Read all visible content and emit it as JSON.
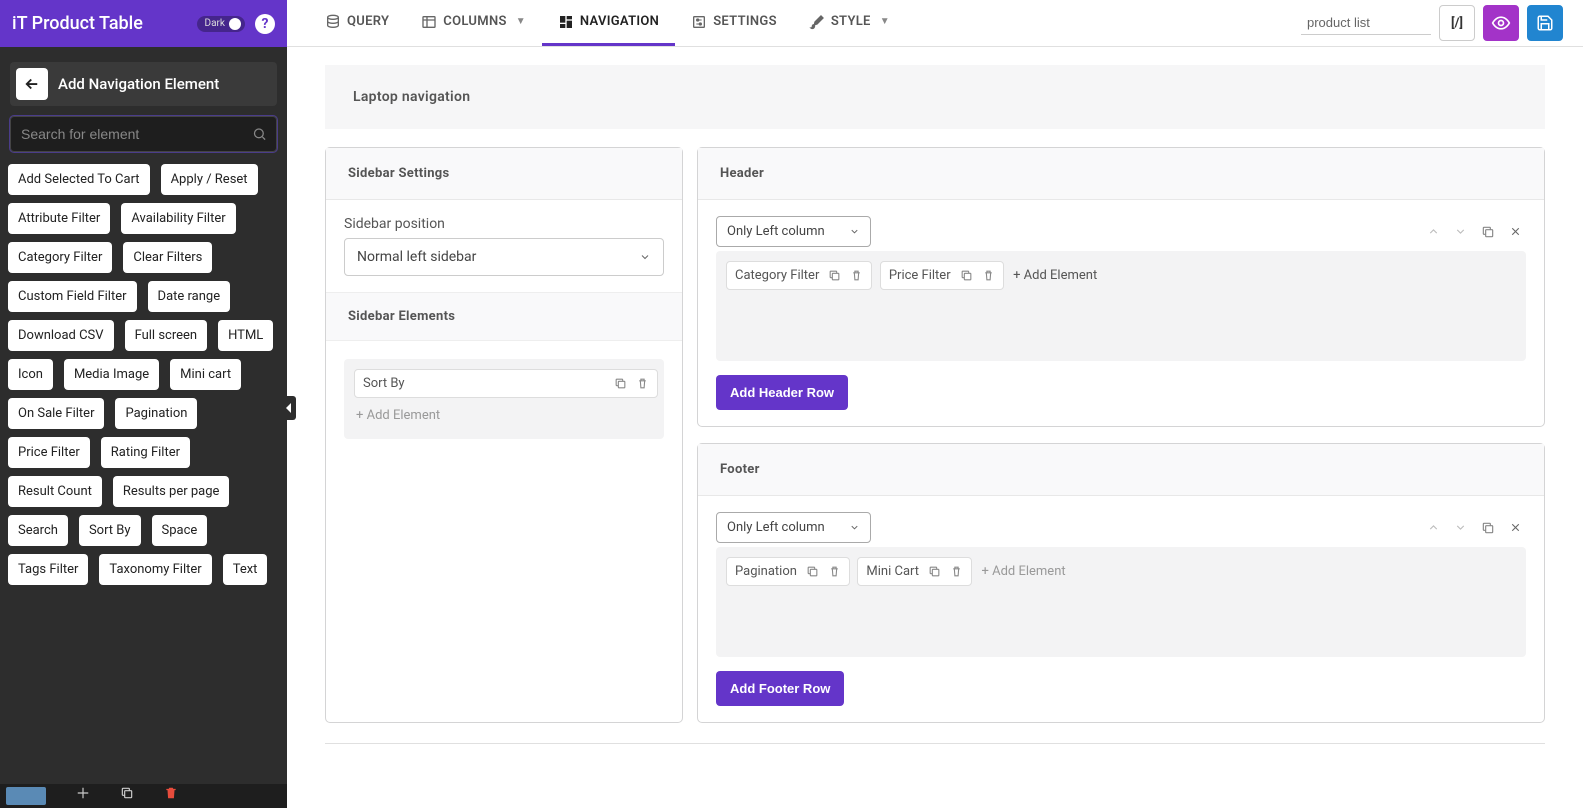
{
  "header": {
    "appTitle": "iT Product Table",
    "darkLabel": "Dark",
    "help": "?"
  },
  "sidebar": {
    "sectionTitle": "Add Navigation Element",
    "searchPlaceholder": "Search for element",
    "chips": [
      "Add Selected To Cart",
      "Apply / Reset",
      "Attribute Filter",
      "Availability Filter",
      "Category Filter",
      "Clear Filters",
      "Custom Field Filter",
      "Date range",
      "Download CSV",
      "Full screen",
      "HTML",
      "Icon",
      "Media Image",
      "Mini cart",
      "On Sale Filter",
      "Pagination",
      "Price Filter",
      "Rating Filter",
      "Result Count",
      "Results per page",
      "Search",
      "Sort By",
      "Space",
      "Tags Filter",
      "Taxonomy Filter",
      "Text"
    ]
  },
  "tabs": {
    "query": "QUERY",
    "columns": "COLUMNS",
    "navigation": "NAVIGATION",
    "settings": "SETTINGS",
    "style": "STYLE"
  },
  "topRight": {
    "nameValue": "product list",
    "codeBtn": "[/]"
  },
  "page": {
    "title": "Laptop navigation"
  },
  "sidebarSettings": {
    "heading": "Sidebar Settings",
    "posLabel": "Sidebar position",
    "posValue": "Normal left sidebar",
    "elementsHeading": "Sidebar Elements",
    "elements": [
      "Sort By"
    ],
    "addEl": "+ Add Element"
  },
  "headerPanel": {
    "heading": "Header",
    "columnMode": "Only Left column",
    "row0": [
      "Category Filter",
      "Price Filter"
    ],
    "addEl": "+ Add Element",
    "addRow": "Add Header Row"
  },
  "footerPanel": {
    "heading": "Footer",
    "columnMode": "Only Left column",
    "row0": [
      "Pagination",
      "Mini Cart"
    ],
    "addEl": "+ Add Element",
    "addRow": "Add Footer Row"
  }
}
